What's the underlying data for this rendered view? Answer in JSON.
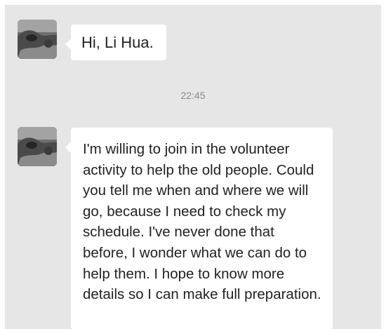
{
  "conversation": {
    "messages": [
      {
        "sender_avatar": "user-avatar",
        "text": "Hi, Li Hua."
      },
      {
        "sender_avatar": "user-avatar",
        "text": "I'm willing to join in the volunteer activity to help the old people. Could you tell me when and where we will go, because I need to check my schedule. I've never done that before, I wonder what we can do to help them. I hope to know more details so I can make full preparation."
      }
    ],
    "timestamp": "22:45"
  }
}
